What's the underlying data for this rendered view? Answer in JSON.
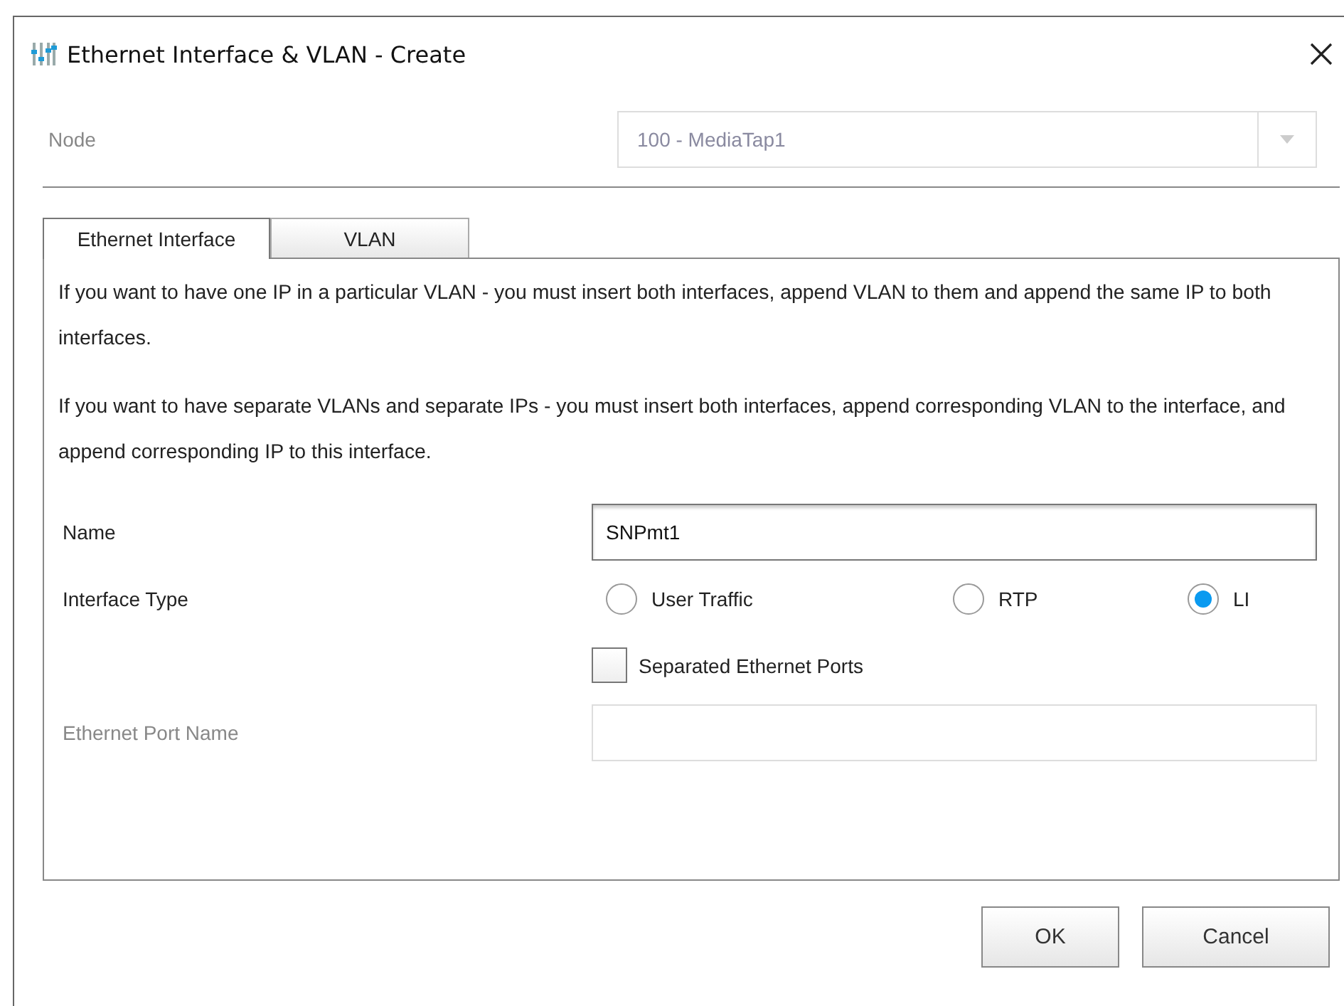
{
  "window": {
    "title": "Ethernet Interface & VLAN - Create"
  },
  "node": {
    "label": "Node",
    "value": "100 - MediaTap1",
    "disabled": true
  },
  "tabs": [
    {
      "label": "Ethernet Interface",
      "selected": true
    },
    {
      "label": "VLAN",
      "selected": false
    }
  ],
  "paragraphs": [
    "If you want to have one IP in a particular VLAN - you must insert both interfaces, append VLAN to them and append the same IP to both interfaces.",
    "If you want to have separate VLANs and separate IPs - you must insert both interfaces, append corresponding VLAN to the interface, and append corresponding IP to this interface."
  ],
  "name": {
    "label": "Name",
    "value": "SNPmt1"
  },
  "interface_type": {
    "label": "Interface Type",
    "options": [
      {
        "label": "User Traffic",
        "selected": false
      },
      {
        "label": "RTP",
        "selected": false
      },
      {
        "label": "LI",
        "selected": true
      }
    ]
  },
  "separated_ports": {
    "label": "Separated Ethernet Ports",
    "checked": false
  },
  "ethernet_port": {
    "label": "Ethernet Port Name",
    "disabled": true
  },
  "buttons": [
    "OK",
    "Cancel"
  ]
}
